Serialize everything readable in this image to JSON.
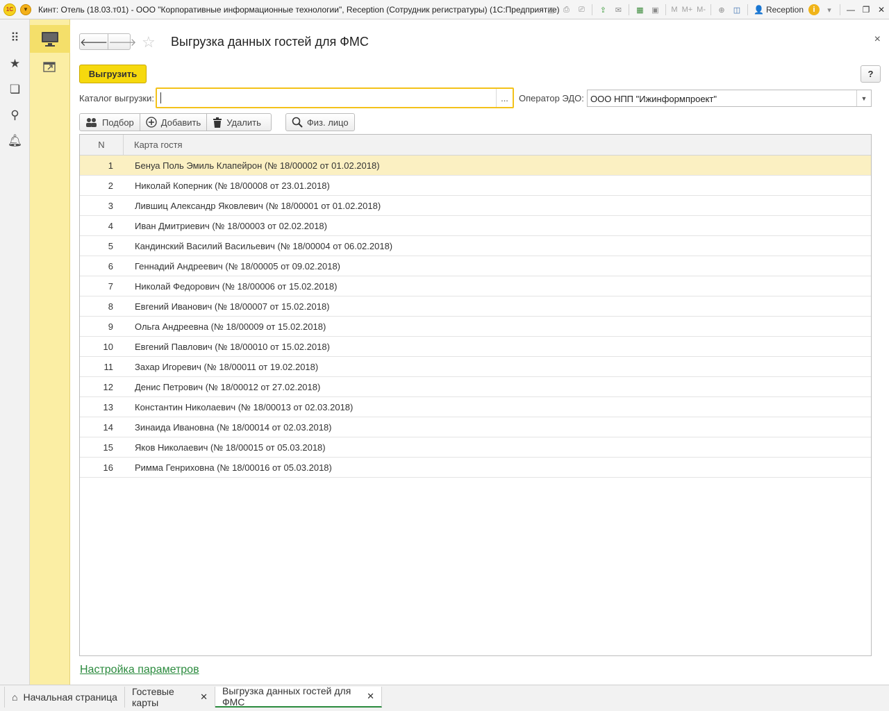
{
  "window": {
    "title": "Кинт: Отель (18.03.т01) - ООО \"Корпоративные информационные технологии\", Reception  (Сотрудник регистратуры)  (1С:Предприятие)",
    "user": "Reception",
    "logo_text": "1С",
    "toolbar_m": [
      "M",
      "M+",
      "M-"
    ]
  },
  "form": {
    "title": "Выгрузка данных гостей для ФМС",
    "export_button": "Выгрузить",
    "help_button": "?",
    "catalog_label": "Каталог выгрузки:",
    "catalog_value": "",
    "catalog_choose": "...",
    "edo_label": "Оператор ЭДО:",
    "edo_value": "ООО НПП \"Ижинформпроект\"",
    "toolbar": {
      "select": "Подбор",
      "add": "Добавить",
      "delete": "Удалить",
      "person": "Физ. лицо"
    },
    "table": {
      "col_n": "N",
      "col_card": "Карта гостя",
      "rows": [
        {
          "n": "1",
          "card": "Бенуа Поль Эмиль Клапейрон (№ 18/00002 от 01.02.2018)"
        },
        {
          "n": "2",
          "card": "Николай Коперник (№ 18/00008 от 23.01.2018)"
        },
        {
          "n": "3",
          "card": "Лившиц Александр Яковлевич (№ 18/00001 от 01.02.2018)"
        },
        {
          "n": "4",
          "card": "Иван Дмитриевич (№ 18/00003 от 02.02.2018)"
        },
        {
          "n": "5",
          "card": "Кандинский Василий Васильевич (№ 18/00004 от 06.02.2018)"
        },
        {
          "n": "6",
          "card": "Геннадий Андреевич (№ 18/00005 от 09.02.2018)"
        },
        {
          "n": "7",
          "card": "Николай Федорович (№ 18/00006 от 15.02.2018)"
        },
        {
          "n": "8",
          "card": "Евгений Иванович (№ 18/00007 от 15.02.2018)"
        },
        {
          "n": "9",
          "card": "Ольга Андреевна (№ 18/00009 от 15.02.2018)"
        },
        {
          "n": "10",
          "card": "Евгений Павлович (№ 18/00010 от 15.02.2018)"
        },
        {
          "n": "11",
          "card": "Захар Игоревич (№ 18/00011 от 19.02.2018)"
        },
        {
          "n": "12",
          "card": "Денис Петрович (№ 18/00012 от 27.02.2018)"
        },
        {
          "n": "13",
          "card": "Константин Николаевич (№ 18/00013 от 02.03.2018)"
        },
        {
          "n": "14",
          "card": "Зинаида Ивановна (№ 18/00014 от 02.03.2018)"
        },
        {
          "n": "15",
          "card": "Яков Николаевич (№ 18/00015 от 05.03.2018)"
        },
        {
          "n": "16",
          "card": "Римма Генриховна (№ 18/00016 от 05.03.2018)"
        }
      ]
    },
    "settings_link": "Настройка параметров"
  },
  "tabs": {
    "home": "Начальная страница",
    "cards": "Гостевые карты",
    "active": "Выгрузка данных гостей для ФМС"
  },
  "colors": {
    "accent_yellow": "#f6d90e",
    "section_panel": "#fbeea4",
    "link_green": "#2a8a3d",
    "selected_row": "#fbf0c2"
  }
}
